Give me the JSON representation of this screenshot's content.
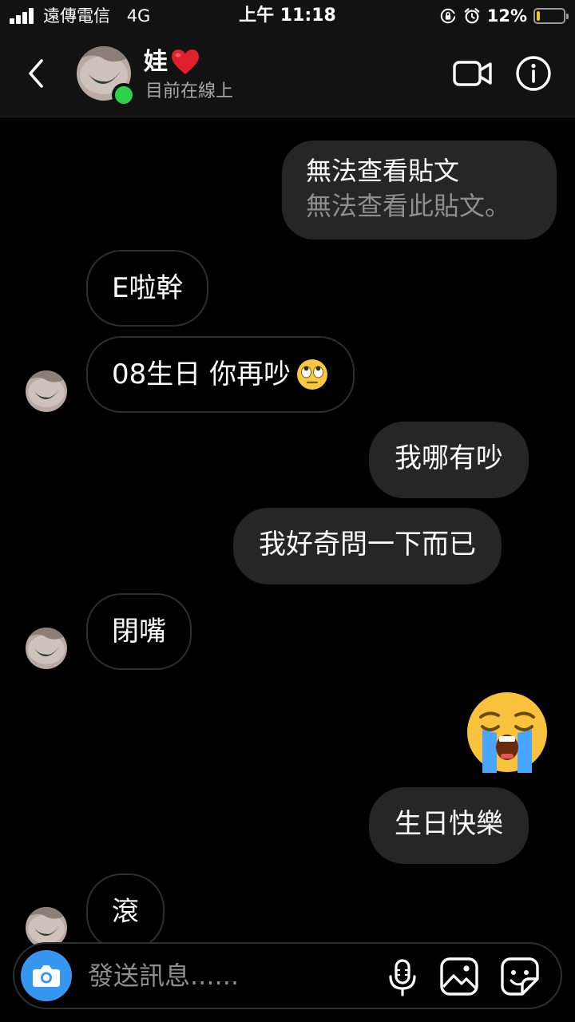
{
  "status_bar": {
    "carrier": "遠傳電信",
    "network": "4G",
    "time": "上午 11:18",
    "battery_percent": "12%",
    "battery_level": 0.12,
    "battery_color": "#f0c419",
    "icons": [
      "signal-icon",
      "orientation-lock-icon",
      "alarm-icon",
      "battery-icon"
    ]
  },
  "header": {
    "contact_name": "娃",
    "name_emoji_icon": "red-heart-icon",
    "contact_status": "目前在線上",
    "online_color": "#2fd14a",
    "icons": [
      "back-icon",
      "video-call-icon",
      "info-icon"
    ]
  },
  "messages": [
    {
      "sender": "me",
      "type": "shared-post",
      "title": "無法查看貼文",
      "subtitle": "無法查看此貼文。"
    },
    {
      "sender": "them",
      "type": "text",
      "text": "E啦幹"
    },
    {
      "sender": "them",
      "type": "text",
      "text": "08生日 你再吵",
      "trailing_emoji": "face-with-rolling-eyes-icon"
    },
    {
      "sender": "me",
      "type": "text",
      "text": "我哪有吵"
    },
    {
      "sender": "me",
      "type": "text",
      "text": "我好奇問一下而已"
    },
    {
      "sender": "them",
      "type": "text",
      "text": "閉嘴"
    },
    {
      "sender": "me",
      "type": "emoji",
      "emoji": "loudly-crying-face-icon"
    },
    {
      "sender": "me",
      "type": "text",
      "text": "生日快樂"
    },
    {
      "sender": "them",
      "type": "text",
      "text": "滾"
    }
  ],
  "composer": {
    "placeholder": "發送訊息......",
    "accent_color": "#3797f0",
    "icons": [
      "camera-icon",
      "microphone-icon",
      "gallery-icon",
      "sticker-icon"
    ]
  }
}
